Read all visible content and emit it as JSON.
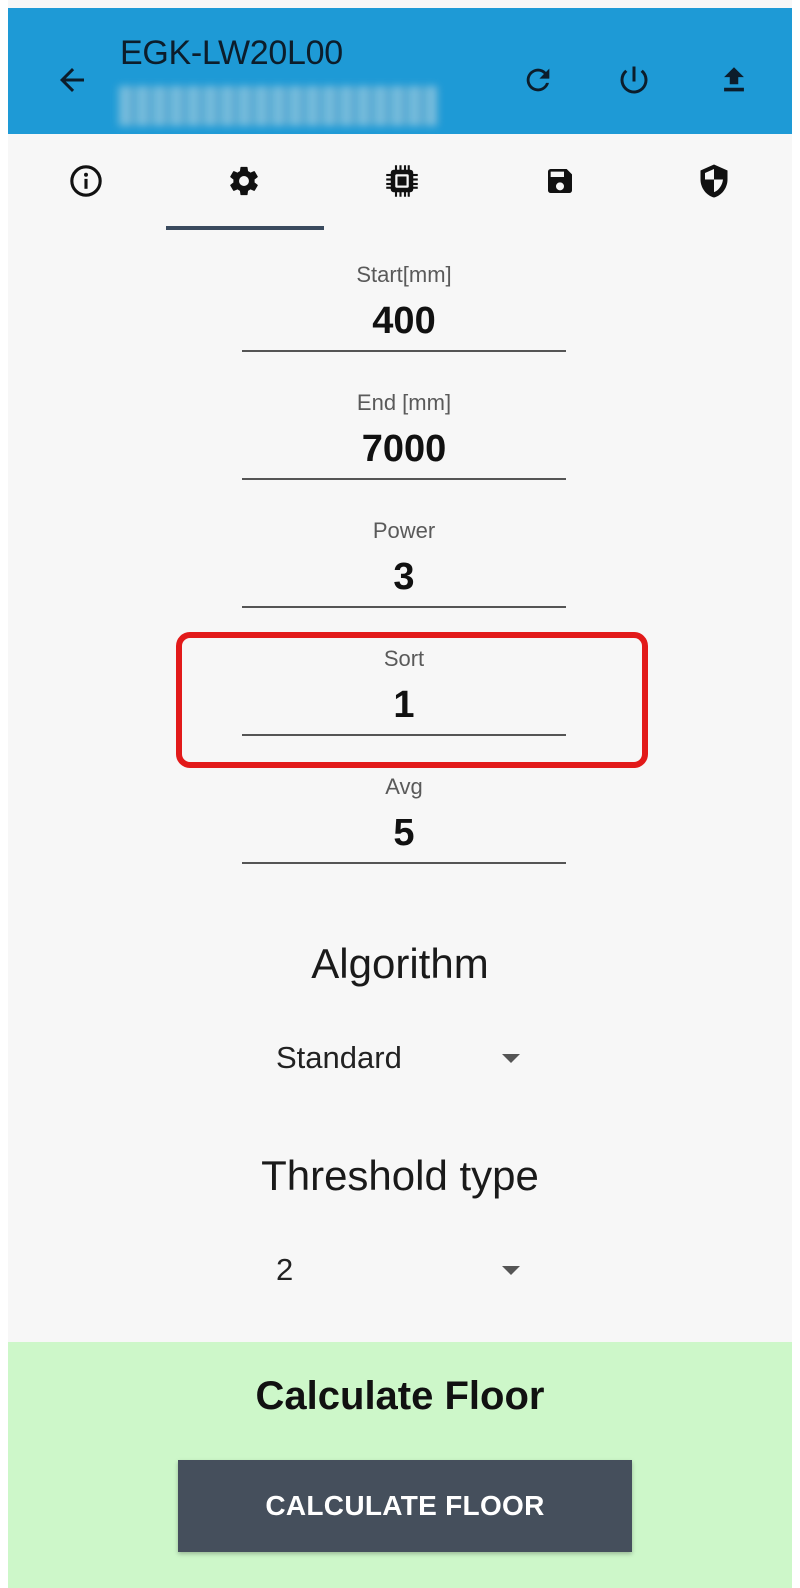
{
  "colors": {
    "appbar": "#1e9ad6",
    "tab_indicator": "#3a4a5e",
    "highlight": "#e21a1a",
    "calc_panel": "#cdf7c9",
    "calc_button": "#454f5c"
  },
  "header": {
    "title": "EGK-LW20L00",
    "subtitle_blurred": true,
    "back_icon": "arrow-left-icon",
    "actions": [
      {
        "icon": "refresh-icon"
      },
      {
        "icon": "power-icon"
      },
      {
        "icon": "upload-icon"
      }
    ]
  },
  "tabs": [
    {
      "icon": "info-icon",
      "selected": false
    },
    {
      "icon": "gear-icon",
      "selected": true
    },
    {
      "icon": "chip-icon",
      "selected": false
    },
    {
      "icon": "save-icon",
      "selected": false
    },
    {
      "icon": "shield-icon",
      "selected": false
    }
  ],
  "fields": {
    "start": {
      "label": "Start[mm]",
      "value": "400"
    },
    "end": {
      "label": "End [mm]",
      "value": "7000"
    },
    "power": {
      "label": "Power",
      "value": "3"
    },
    "sort": {
      "label": "Sort",
      "value": "1",
      "highlighted": true
    },
    "avg": {
      "label": "Avg",
      "value": "5"
    }
  },
  "algorithm": {
    "title": "Algorithm",
    "selected": "Standard"
  },
  "threshold": {
    "title": "Threshold type",
    "selected": "2"
  },
  "calculate": {
    "heading": "Calculate Floor",
    "button_label": "CALCULATE FLOOR"
  }
}
